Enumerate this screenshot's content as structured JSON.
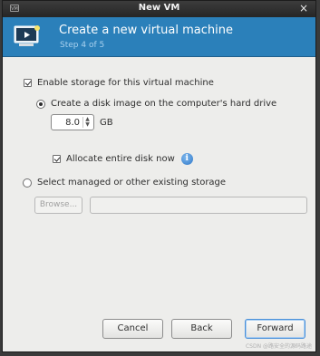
{
  "window": {
    "title": "New VM",
    "app_icon_label": "VM",
    "close_glyph": "×"
  },
  "header": {
    "title": "Create a new virtual machine",
    "step": "Step 4 of 5",
    "background": "#2b80ba",
    "icon": "computer-monitor-icon"
  },
  "storage": {
    "enable_label": "Enable storage for this virtual machine",
    "enable_checked": true,
    "create_disk_label": "Create a disk image on the computer's hard drive",
    "create_disk_selected": true,
    "size_value": "8.0",
    "size_unit": "GB",
    "allocate_label": "Allocate entire disk now",
    "allocate_checked": true,
    "info_glyph": "i",
    "select_existing_label": "Select managed or other existing storage",
    "select_existing_selected": false,
    "browse_label": "Browse...",
    "path_value": ""
  },
  "buttons": {
    "cancel": "Cancel",
    "back": "Back",
    "forward": "Forward"
  },
  "watermark": "CSDN @路安全的源码路途"
}
